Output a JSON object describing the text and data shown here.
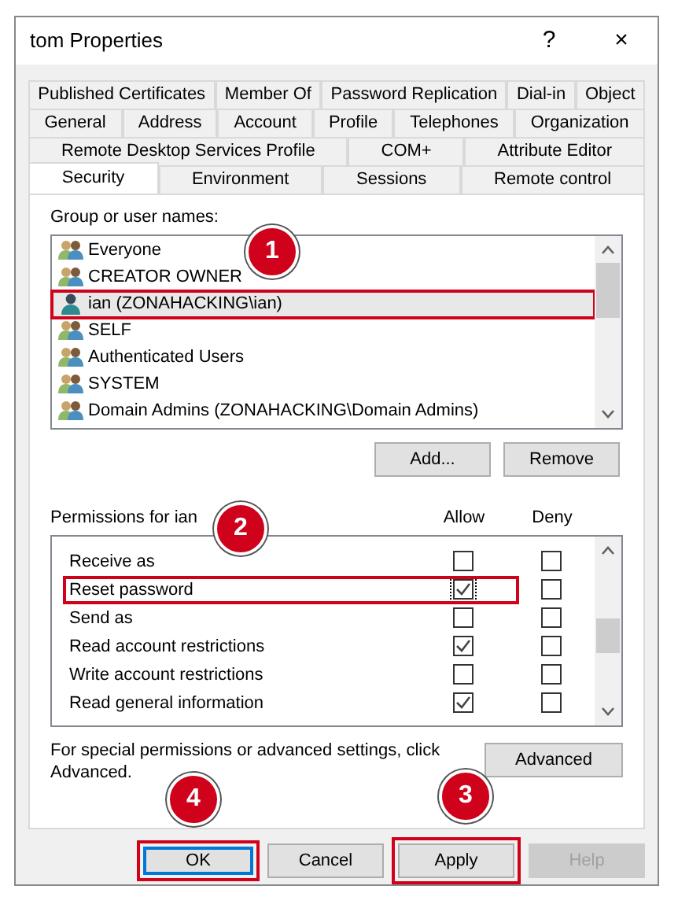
{
  "window": {
    "title": "tom Properties",
    "help": "?",
    "close": "×"
  },
  "tab_rows": [
    [
      {
        "label": "Published Certificates",
        "selected": false
      },
      {
        "label": "Member Of",
        "selected": false
      },
      {
        "label": "Password Replication",
        "selected": false
      },
      {
        "label": "Dial-in",
        "selected": false
      },
      {
        "label": "Object",
        "selected": false
      }
    ],
    [
      {
        "label": "General",
        "selected": false
      },
      {
        "label": "Address",
        "selected": false
      },
      {
        "label": "Account",
        "selected": false
      },
      {
        "label": "Profile",
        "selected": false
      },
      {
        "label": "Telephones",
        "selected": false
      },
      {
        "label": "Organization",
        "selected": false
      }
    ],
    [
      {
        "label": "Remote Desktop Services Profile",
        "selected": false
      },
      {
        "label": "COM+",
        "selected": false
      },
      {
        "label": "Attribute Editor",
        "selected": false
      }
    ],
    [
      {
        "label": "Security",
        "selected": true
      },
      {
        "label": "Environment",
        "selected": false
      },
      {
        "label": "Sessions",
        "selected": false
      },
      {
        "label": "Remote control",
        "selected": false
      }
    ]
  ],
  "users_label": "Group or user names:",
  "users": [
    {
      "name": "Everyone",
      "kind": "group",
      "selected": false,
      "highlighted": false
    },
    {
      "name": "CREATOR OWNER",
      "kind": "group",
      "selected": false,
      "highlighted": false
    },
    {
      "name": "ian (ZONAHACKING\\ian)",
      "kind": "user",
      "selected": true,
      "highlighted": true
    },
    {
      "name": "SELF",
      "kind": "group",
      "selected": false,
      "highlighted": false
    },
    {
      "name": "Authenticated Users",
      "kind": "group",
      "selected": false,
      "highlighted": false
    },
    {
      "name": "SYSTEM",
      "kind": "group",
      "selected": false,
      "highlighted": false
    },
    {
      "name": "Domain Admins (ZONAHACKING\\Domain Admins)",
      "kind": "group",
      "selected": false,
      "highlighted": false
    }
  ],
  "user_buttons": [
    "Add...",
    "Remove"
  ],
  "permissions_label": "Permissions for ian",
  "allow_header": "Allow",
  "deny_header": "Deny",
  "permissions": [
    {
      "label": "Receive as",
      "allow": false,
      "deny": false,
      "highlighted": false
    },
    {
      "label": "Reset password",
      "allow": true,
      "deny": false,
      "highlighted": true
    },
    {
      "label": "Send as",
      "allow": false,
      "deny": false,
      "highlighted": false
    },
    {
      "label": "Read account restrictions",
      "allow": true,
      "deny": false,
      "highlighted": false
    },
    {
      "label": "Write account restrictions",
      "allow": false,
      "deny": false,
      "highlighted": false
    },
    {
      "label": "Read general information",
      "allow": true,
      "deny": false,
      "highlighted": false
    }
  ],
  "advanced_text": "For special permissions or advanced settings, click Advanced.",
  "advanced_button": "Advanced",
  "buttons": [
    {
      "label": "OK",
      "default": true,
      "disabled": false,
      "highlighted": true
    },
    {
      "label": "Cancel",
      "default": false,
      "disabled": false,
      "highlighted": false
    },
    {
      "label": "Apply",
      "default": false,
      "disabled": false,
      "highlighted": true
    },
    {
      "label": "Help",
      "default": false,
      "disabled": true,
      "highlighted": false
    }
  ],
  "callouts": [
    "1",
    "2",
    "3",
    "4"
  ]
}
